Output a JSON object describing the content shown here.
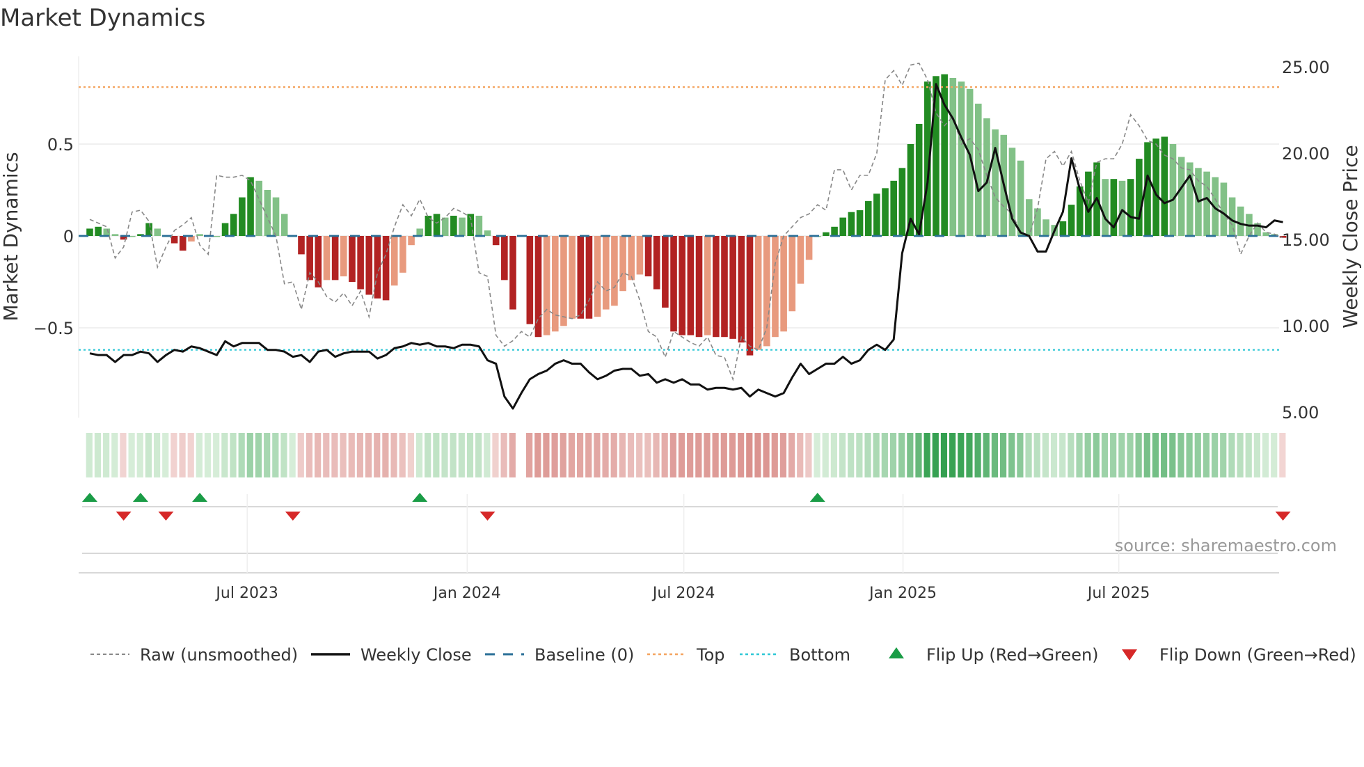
{
  "chart_data": {
    "type": "bar",
    "title": "Market Dynamics",
    "ylabel": "Market Dynamics",
    "y2label": "Weekly Close Price",
    "ylim": [
      -0.98,
      0.98
    ],
    "y2lim": [
      5,
      25
    ],
    "yticks": [
      {
        "v": 0.5,
        "label": "0.5"
      },
      {
        "v": 0,
        "label": "0"
      },
      {
        "v": -0.5,
        "label": "−0.5"
      }
    ],
    "y2ticks": [
      {
        "v": 25,
        "label": "25.00"
      },
      {
        "v": 20,
        "label": "20.00"
      },
      {
        "v": 15,
        "label": "15.00"
      },
      {
        "v": 10,
        "label": "10.00"
      },
      {
        "v": 5,
        "label": "5.00"
      }
    ],
    "x_start": "2023-02-20",
    "x_frequency": "weekly",
    "xticks": [
      {
        "week": 18.6,
        "label": "Jul 2023"
      },
      {
        "week": 44.6,
        "label": "Jan 2024"
      },
      {
        "week": 70.2,
        "label": "Jul 2024"
      },
      {
        "week": 96.1,
        "label": "Jan 2025"
      },
      {
        "week": 121.6,
        "label": "Jul 2025"
      }
    ],
    "top_level": 0.81,
    "bottom_level": -0.62,
    "baseline": 0,
    "series": [
      {
        "name": "Market Dynamics",
        "values": [
          0.04,
          0.05,
          0.04,
          0.01,
          -0.02,
          0.0,
          0.01,
          0.07,
          0.04,
          0.0,
          -0.04,
          -0.08,
          -0.03,
          0.01,
          0.005,
          0.0,
          0.07,
          0.12,
          0.21,
          0.32,
          0.3,
          0.25,
          0.21,
          0.12,
          0.0,
          -0.1,
          -0.24,
          -0.28,
          -0.24,
          -0.24,
          -0.22,
          -0.25,
          -0.29,
          -0.32,
          -0.34,
          -0.35,
          -0.27,
          -0.2,
          -0.05,
          0.04,
          0.11,
          0.12,
          0.1,
          0.11,
          0.1,
          0.12,
          0.11,
          0.03,
          -0.05,
          -0.24,
          -0.4,
          null,
          -0.48,
          -0.55,
          -0.54,
          -0.52,
          -0.49,
          -0.45,
          -0.45,
          -0.45,
          -0.44,
          -0.4,
          -0.38,
          -0.3,
          -0.24,
          -0.21,
          -0.22,
          -0.29,
          -0.39,
          -0.52,
          -0.54,
          -0.54,
          -0.55,
          -0.54,
          -0.55,
          -0.55,
          -0.56,
          -0.58,
          -0.65,
          -0.62,
          -0.6,
          -0.55,
          -0.52,
          -0.41,
          -0.26,
          -0.13,
          0.0,
          0.02,
          0.05,
          0.1,
          0.13,
          0.14,
          0.19,
          0.23,
          0.26,
          0.3,
          0.37,
          0.5,
          0.61,
          0.84,
          0.87,
          0.88,
          0.86,
          0.84,
          0.8,
          0.72,
          0.64,
          0.58,
          0.55,
          0.48,
          0.41,
          0.2,
          0.15,
          0.09,
          0.06,
          0.08,
          0.17,
          0.27,
          0.35,
          0.4,
          0.31,
          0.31,
          0.3,
          0.31,
          0.42,
          0.51,
          0.53,
          0.54,
          0.5,
          0.43,
          0.4,
          0.37,
          0.35,
          0.32,
          0.29,
          0.21,
          0.16,
          0.12,
          0.07,
          0.02,
          0.01,
          -0.01
        ]
      },
      {
        "name": "Raw (unsmoothed)",
        "values": [
          0.09,
          0.07,
          0.05,
          -0.12,
          -0.06,
          0.13,
          0.14,
          0.08,
          -0.17,
          -0.06,
          0.03,
          0.06,
          0.1,
          -0.05,
          -0.1,
          0.33,
          0.32,
          0.32,
          0.33,
          0.3,
          0.2,
          0.1,
          0.0,
          -0.26,
          -0.25,
          -0.4,
          -0.2,
          -0.25,
          -0.33,
          -0.36,
          -0.31,
          -0.38,
          -0.3,
          -0.44,
          -0.2,
          -0.1,
          0.05,
          0.17,
          0.11,
          0.2,
          0.1,
          0.07,
          0.1,
          0.15,
          0.13,
          0.1,
          -0.2,
          -0.22,
          -0.54,
          -0.6,
          -0.57,
          -0.52,
          -0.55,
          -0.45,
          -0.4,
          -0.43,
          -0.44,
          -0.45,
          -0.43,
          -0.35,
          -0.25,
          -0.3,
          -0.28,
          -0.2,
          -0.22,
          -0.35,
          -0.52,
          -0.55,
          -0.66,
          -0.52,
          -0.55,
          -0.58,
          -0.6,
          -0.55,
          -0.65,
          -0.66,
          -0.78,
          -0.55,
          -0.6,
          -0.62,
          -0.5,
          -0.15,
          0.0,
          0.05,
          0.1,
          0.12,
          0.17,
          0.14,
          0.36,
          0.36,
          0.25,
          0.33,
          0.33,
          0.45,
          0.85,
          0.9,
          0.82,
          0.93,
          0.94,
          0.85,
          0.67,
          0.6,
          0.65,
          0.5,
          0.53,
          0.47,
          0.33,
          0.21,
          0.16,
          0.12,
          0.02,
          0.0,
          0.15,
          0.42,
          0.46,
          0.38,
          0.46,
          0.3,
          0.18,
          0.4,
          0.42,
          0.42,
          0.5,
          0.66,
          0.6,
          0.52,
          0.5,
          0.44,
          0.42,
          0.37,
          0.36,
          0.3,
          0.27,
          0.2,
          0.12,
          0.06,
          -0.1,
          0.0,
          0.07,
          0.02,
          0.01,
          -0.01
        ]
      },
      {
        "name": "Weekly Close",
        "axis": "right",
        "values": [
          8.4,
          8.3,
          8.3,
          7.9,
          8.3,
          8.3,
          8.5,
          8.4,
          7.9,
          8.3,
          8.6,
          8.5,
          8.8,
          8.7,
          8.5,
          8.3,
          9.1,
          8.8,
          9.0,
          9.0,
          9.0,
          8.6,
          8.6,
          8.5,
          8.2,
          8.3,
          7.9,
          8.5,
          8.6,
          8.2,
          8.4,
          8.5,
          8.5,
          8.5,
          8.1,
          8.3,
          8.7,
          8.8,
          9.0,
          8.9,
          9.0,
          8.8,
          8.8,
          8.7,
          8.9,
          8.9,
          8.8,
          8.0,
          7.8,
          5.9,
          5.2,
          6.1,
          6.9,
          7.2,
          7.4,
          7.8,
          8.0,
          7.8,
          7.8,
          7.3,
          6.9,
          7.1,
          7.4,
          7.5,
          7.5,
          7.1,
          7.2,
          6.7,
          6.9,
          6.7,
          6.9,
          6.6,
          6.6,
          6.3,
          6.4,
          6.4,
          6.3,
          6.4,
          5.9,
          6.3,
          6.1,
          5.9,
          6.1,
          7.0,
          7.8,
          7.2,
          7.5,
          7.8,
          7.8,
          8.2,
          7.8,
          8.0,
          8.6,
          8.9,
          8.6,
          9.2,
          14.2,
          16.2,
          15.3,
          18.3,
          24.0,
          22.8,
          22.0,
          20.9,
          19.9,
          17.8,
          18.3,
          20.3,
          18.2,
          16.2,
          15.4,
          15.2,
          14.3,
          14.3,
          15.5,
          16.6,
          19.7,
          17.9,
          16.6,
          17.4,
          16.2,
          15.7,
          16.7,
          16.3,
          16.2,
          18.7,
          17.6,
          17.1,
          17.3,
          18.0,
          18.7,
          17.2,
          17.4,
          16.8,
          16.5,
          16.1,
          15.9,
          15.8,
          15.8,
          15.7,
          16.1,
          16.0
        ]
      }
    ],
    "flip_up_weeks": [
      0,
      6,
      13,
      39,
      86
    ],
    "flip_down_weeks": [
      4,
      9,
      24,
      47,
      141
    ],
    "legend_position": "bottom",
    "colors": {
      "up_strong": "#228b22",
      "up_weak": "#82c187",
      "down_strong": "#b22222",
      "down_weak": "#e89a7e",
      "top": "#f4a460",
      "bottom": "#2ec7d6",
      "baseline": "#2a6f97",
      "raw": "#888888",
      "close": "#111111",
      "flip_up": "#1a9c46",
      "flip_down": "#d62828"
    }
  },
  "legend": [
    {
      "label": "Raw (unsmoothed)",
      "icon": "dashed-line"
    },
    {
      "label": "Weekly Close",
      "icon": "solid-line"
    },
    {
      "label": "Baseline (0)",
      "icon": "dashed-line"
    },
    {
      "label": "Top",
      "icon": "dotted-line"
    },
    {
      "label": "Bottom",
      "icon": "dotted-line"
    },
    {
      "label": "Flip Up (Red→Green)",
      "icon": "triangle-up"
    },
    {
      "label": "Flip Down (Green→Red)",
      "icon": "triangle-down"
    }
  ],
  "source": "source: sharemaestro.com"
}
